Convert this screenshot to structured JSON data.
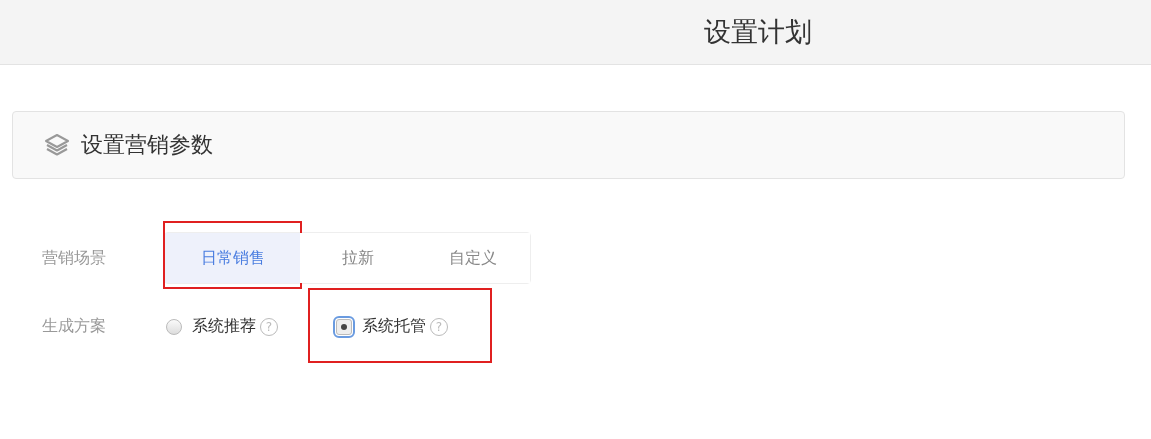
{
  "header": {
    "title": "设置计划"
  },
  "section": {
    "title": "设置营销参数"
  },
  "scene": {
    "label": "营销场景",
    "options": [
      {
        "label": "日常销售",
        "selected": true,
        "highlighted": true
      },
      {
        "label": "拉新",
        "selected": false,
        "highlighted": false
      },
      {
        "label": "自定义",
        "selected": false,
        "highlighted": false
      }
    ]
  },
  "plan": {
    "label": "生成方案",
    "options": [
      {
        "label": "系统推荐",
        "help": "?",
        "selected": false,
        "highlighted": false
      },
      {
        "label": "系统托管",
        "help": "?",
        "selected": true,
        "highlighted": true
      }
    ]
  }
}
